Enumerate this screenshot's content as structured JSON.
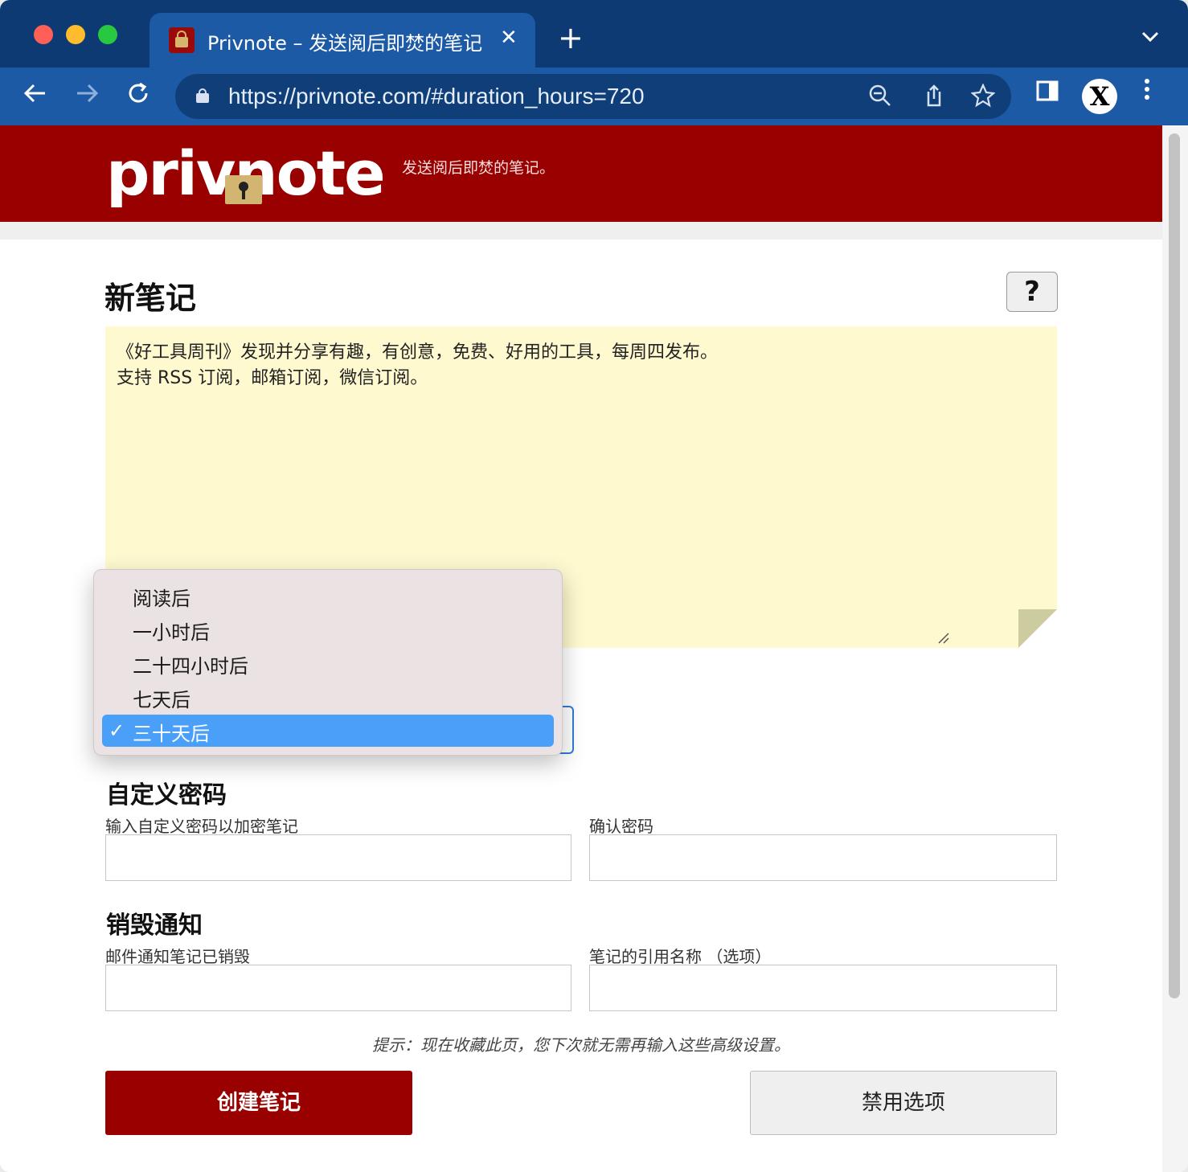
{
  "browser": {
    "tab": {
      "title": "Privnote – 发送阅后即焚的笔记",
      "close": "✕"
    },
    "new_tab": "+",
    "tab_menu": "⌄",
    "url": "https://privnote.com/#duration_hours=720",
    "icons": [
      "back-icon",
      "forward-icon",
      "reload-icon",
      "lock-icon",
      "zoom-icon",
      "share-icon",
      "star-icon",
      "sidebar-icon",
      "x-extension-icon",
      "kebab-menu-icon"
    ],
    "avatar_letter": "X"
  },
  "header": {
    "logo": "privnote",
    "tagline": "发送阅后即焚的笔记。",
    "brand_color": "#990000"
  },
  "main": {
    "title": "新笔记",
    "help_label": "?",
    "note_lines": [
      "《好工具周刊》发现并分享有趣，有创意，免费、好用的工具，每周四发布。",
      "支持 RSS 订阅，邮箱订阅，微信订阅。"
    ]
  },
  "expiry": {
    "options": [
      "阅读后",
      "一小时后",
      "二十四小时后",
      "七天后",
      "三十天后"
    ],
    "selected": "三十天后",
    "check": "✓"
  },
  "password": {
    "section_title": "自定义密码",
    "label": "输入自定义密码以加密笔记",
    "confirm_label": "确认密码",
    "value": "",
    "confirm_value": ""
  },
  "notify": {
    "section_title": "销毁通知",
    "email_label": "邮件通知笔记已销毁",
    "reference_label": "笔记的引用名称 （选项）",
    "email_value": "",
    "reference_value": ""
  },
  "hint": "提示：现在收藏此页，您下次就无需再输入这些高级设置。",
  "actions": {
    "create": "创建笔记",
    "disable_options": "禁用选项"
  }
}
